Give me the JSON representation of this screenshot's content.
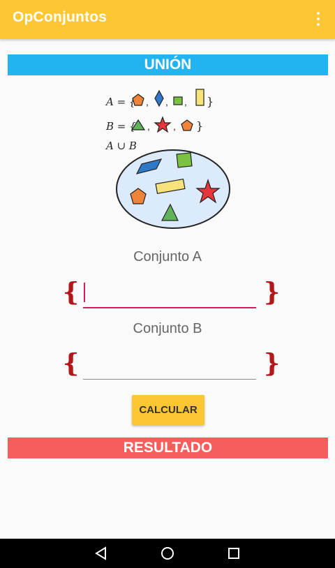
{
  "app": {
    "title": "OpConjuntos"
  },
  "sections": {
    "union": "UNIÓN",
    "result": "RESULTADO"
  },
  "illustration": {
    "set_a_label": "A = {",
    "set_b_label": "B = {",
    "union_label": "A ∪ B",
    "close_brace": "}"
  },
  "form": {
    "conjunto_a_label": "Conjunto A",
    "conjunto_b_label": "Conjunto B",
    "open_brace": "{",
    "close_brace": "}",
    "conjunto_a_value": "",
    "conjunto_b_value": "",
    "calcular_label": "CALCULAR"
  },
  "colors": {
    "primary": "#fdc633",
    "union": "#22b4f0",
    "result": "#f65e5e",
    "brace": "#b2171b",
    "focus": "#d81b60"
  },
  "navbar": {
    "icons": [
      "back-icon",
      "home-icon",
      "recents-icon"
    ]
  }
}
